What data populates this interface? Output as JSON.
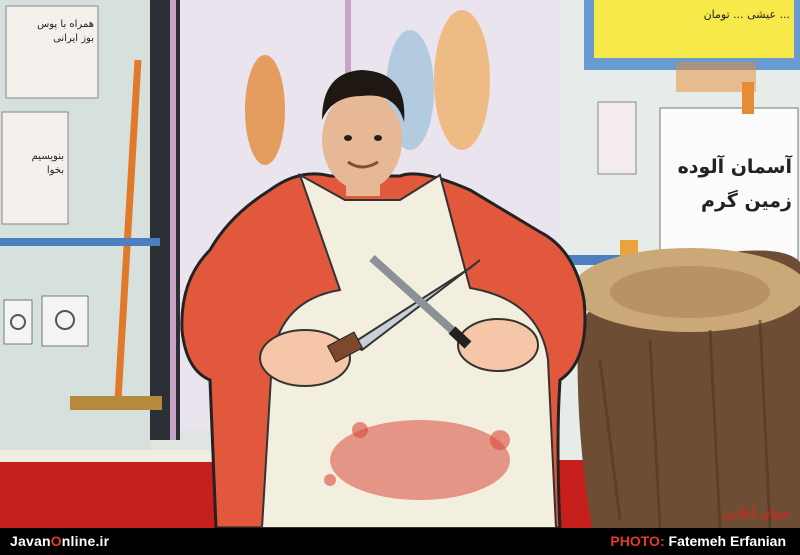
{
  "photo": {
    "subject": "man-in-butcher-cardboard-cutout",
    "sign_top_left": [
      "همراه با پوس",
      "بوز ایرانی"
    ],
    "sign_left_mid": [
      "بنویسیم",
      "بخوا"
    ],
    "sign_top_right": "... عیشی ... تومان",
    "sign_right": [
      "آسمان آلوده",
      "زمین گرم"
    ],
    "watermark": "جوان آنلاین"
  },
  "caption": {
    "site_prefix": "Javan",
    "site_highlight": "O",
    "site_suffix": "nline.ir",
    "credit_label": "PHOTO:",
    "credit_name": "Fatemeh Erfanian"
  }
}
